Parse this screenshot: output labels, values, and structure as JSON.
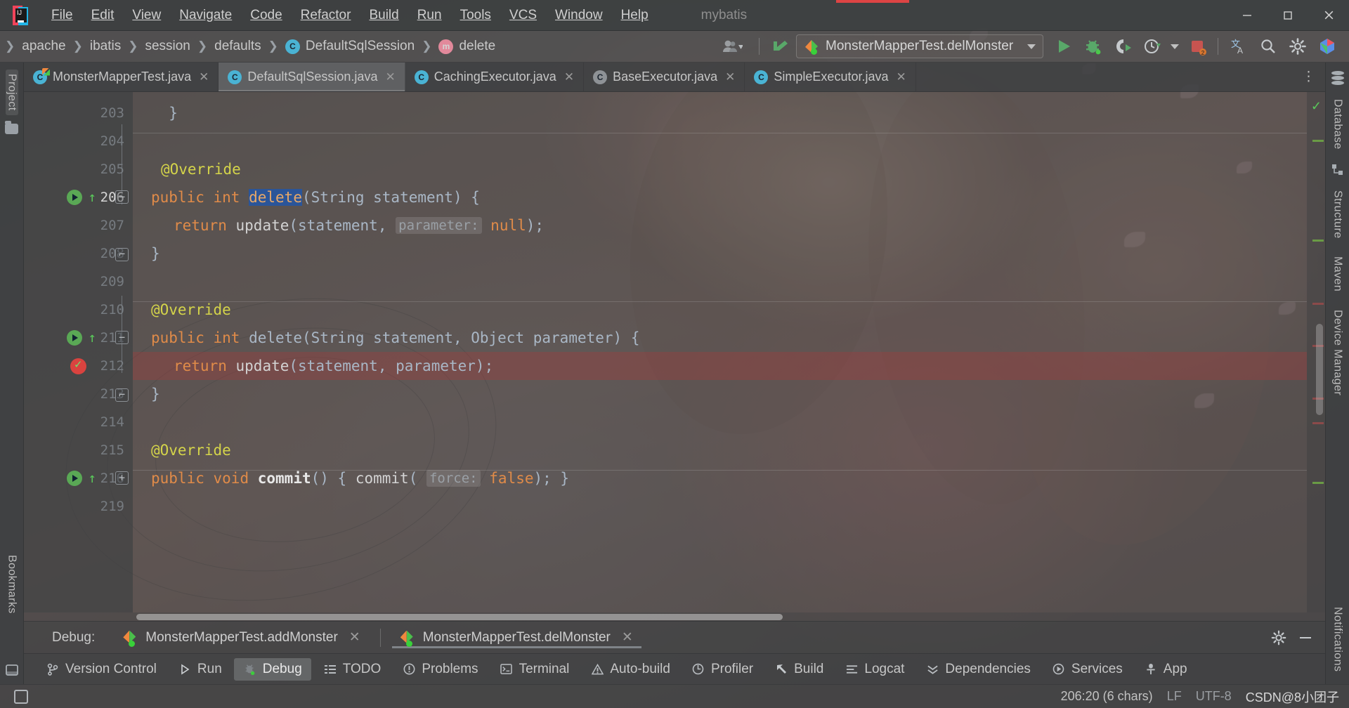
{
  "window": {
    "project_name": "mybatis",
    "logo_text": "IJ",
    "minimize": "—",
    "maximize": "▢",
    "close": "✕"
  },
  "menu": [
    {
      "label": "File",
      "accel": "F"
    },
    {
      "label": "Edit",
      "accel": "E"
    },
    {
      "label": "View",
      "accel": "V"
    },
    {
      "label": "Navigate",
      "accel": "N"
    },
    {
      "label": "Code",
      "accel": "C"
    },
    {
      "label": "Refactor",
      "accel": "R"
    },
    {
      "label": "Build",
      "accel": "B"
    },
    {
      "label": "Run",
      "accel": "u"
    },
    {
      "label": "Tools",
      "accel": "T"
    },
    {
      "label": "VCS",
      "accel": "S"
    },
    {
      "label": "Window",
      "accel": "W"
    },
    {
      "label": "Help",
      "accel": "H"
    }
  ],
  "breadcrumb": {
    "items": [
      {
        "label": "apache",
        "icon": ""
      },
      {
        "label": "ibatis",
        "icon": ""
      },
      {
        "label": "session",
        "icon": ""
      },
      {
        "label": "defaults",
        "icon": ""
      },
      {
        "label": "DefaultSqlSession",
        "icon": "class-icon",
        "icon_letter": "C"
      },
      {
        "label": "delete",
        "icon": "method-icon",
        "icon_letter": "m"
      }
    ],
    "separator": "❯"
  },
  "toolbar": {
    "run_config": "MonsterMapperTest.delMonster",
    "icons": [
      {
        "name": "avatar-icon",
        "glyph": "person"
      },
      {
        "name": "update-project-icon",
        "glyph": "arrow"
      },
      {
        "name": "run-icon",
        "glyph": "play"
      },
      {
        "name": "debug-icon",
        "glyph": "bug"
      },
      {
        "name": "run-with-coverage-icon",
        "glyph": "coverage"
      },
      {
        "name": "profiler-icon",
        "glyph": "clock"
      },
      {
        "name": "stop-icon",
        "glyph": "stop"
      },
      {
        "name": "translate-icon",
        "glyph": "translate"
      },
      {
        "name": "search-everywhere-icon",
        "glyph": "search"
      },
      {
        "name": "settings-icon",
        "glyph": "gear"
      },
      {
        "name": "account-icon",
        "glyph": "account"
      }
    ]
  },
  "editor_tabs": [
    {
      "label": "MonsterMapperTest.java",
      "icon": "test-class-icon",
      "icon_letter": "C",
      "active": false,
      "closable": true
    },
    {
      "label": "DefaultSqlSession.java",
      "icon": "class-icon",
      "icon_letter": "C",
      "active": true,
      "closable": true
    },
    {
      "label": "CachingExecutor.java",
      "icon": "class-icon",
      "icon_letter": "C",
      "active": false,
      "closable": true
    },
    {
      "label": "BaseExecutor.java",
      "icon": "abstract-class-icon",
      "icon_letter": "C",
      "active": false,
      "closable": true
    },
    {
      "label": "SimpleExecutor.java",
      "icon": "class-icon",
      "icon_letter": "C",
      "active": false,
      "closable": true
    }
  ],
  "tool_stripes": {
    "left": [
      "Project",
      "Bookmarks"
    ],
    "right": [
      "Database",
      "Structure",
      "Maven",
      "Device Manager",
      "Notifications"
    ]
  },
  "code": {
    "lines": [
      {
        "num": "203",
        "text": "  }",
        "current": false
      },
      {
        "num": "204",
        "text": "",
        "current": false
      },
      {
        "num": "205",
        "text": "@Override",
        "current": false
      },
      {
        "num": "206",
        "text": "public int delete(String statement) {",
        "current": true
      },
      {
        "num": "207",
        "text": "  return update(statement, parameter: null);",
        "current": false
      },
      {
        "num": "208",
        "text": "}",
        "current": false
      },
      {
        "num": "209",
        "text": "",
        "current": false
      },
      {
        "num": "210",
        "text": "@Override",
        "current": false
      },
      {
        "num": "211",
        "text": "public int delete(String statement, Object parameter) {",
        "current": false
      },
      {
        "num": "212",
        "text": "  return update(statement, parameter);",
        "current": false
      },
      {
        "num": "213",
        "text": "}",
        "current": false
      },
      {
        "num": "214",
        "text": "",
        "current": false
      },
      {
        "num": "215",
        "text": "@Override",
        "current": false
      },
      {
        "num": "216",
        "text": "public void commit() { commit( force: false); }",
        "current": false
      },
      {
        "num": "219",
        "text": "",
        "current": false
      }
    ],
    "tokens": {
      "override": "@Override",
      "public": "public",
      "int": "int",
      "void": "void",
      "return": "return",
      "delete": "delete",
      "update": "update",
      "commit": "commit",
      "string_type": "String",
      "object_type": "Object",
      "statement": "statement",
      "parameter": "parameter",
      "null_lit": "null",
      "false_lit": "false",
      "hint_parameter": "parameter:",
      "hint_force": "force:"
    }
  },
  "debug_panel": {
    "label": "Debug:",
    "sessions": [
      {
        "label": "MonsterMapperTest.addMonster",
        "active": false,
        "close": "✕"
      },
      {
        "label": "MonsterMapperTest.delMonster",
        "active": true,
        "close": "✕"
      }
    ],
    "settings_icon": "gear-icon",
    "minimize_icon": "minimize-icon"
  },
  "bottom_tools": [
    {
      "label": "Version Control",
      "icon": "branch-icon",
      "glyph": "⑂",
      "active": false
    },
    {
      "label": "Run",
      "icon": "play-icon",
      "glyph": "▶",
      "active": false
    },
    {
      "label": "Debug",
      "icon": "bug-icon",
      "glyph": "bug",
      "active": true
    },
    {
      "label": "TODO",
      "icon": "list-icon",
      "glyph": "☰",
      "active": false
    },
    {
      "label": "Problems",
      "icon": "warning-circle-icon",
      "glyph": "❶",
      "active": false
    },
    {
      "label": "Terminal",
      "icon": "terminal-icon",
      "glyph": "▣",
      "active": false
    },
    {
      "label": "Auto-build",
      "icon": "warning-icon",
      "glyph": "⚠",
      "active": false
    },
    {
      "label": "Profiler",
      "icon": "profiler-icon",
      "glyph": "◔",
      "active": false
    },
    {
      "label": "Build",
      "icon": "hammer-icon",
      "glyph": "🔨",
      "active": false
    },
    {
      "label": "Logcat",
      "icon": "logcat-icon",
      "glyph": "≡",
      "active": false
    },
    {
      "label": "Dependencies",
      "icon": "dependencies-icon",
      "glyph": "❯❯",
      "active": false
    },
    {
      "label": "Services",
      "icon": "services-icon",
      "glyph": "◑",
      "active": false
    },
    {
      "label": "App",
      "icon": "app-icon",
      "glyph": "⚲",
      "active": false
    }
  ],
  "status_bar": {
    "caret_position": "206:20 (6 chars)",
    "line_separator": "LF",
    "encoding": "UTF-8",
    "watermark": "CSDN@8小团子"
  },
  "colors": {
    "accent_green": "#5aa855",
    "breakpoint_red": "#d9433f",
    "annotation_yellow": "#d4d44a",
    "keyword_orange": "#e08b49",
    "plain_text": "#a9b7c6",
    "selection_blue": "#2b5599",
    "class_icon_blue": "#4ab3d4",
    "method_icon_pink": "#e2899b"
  }
}
